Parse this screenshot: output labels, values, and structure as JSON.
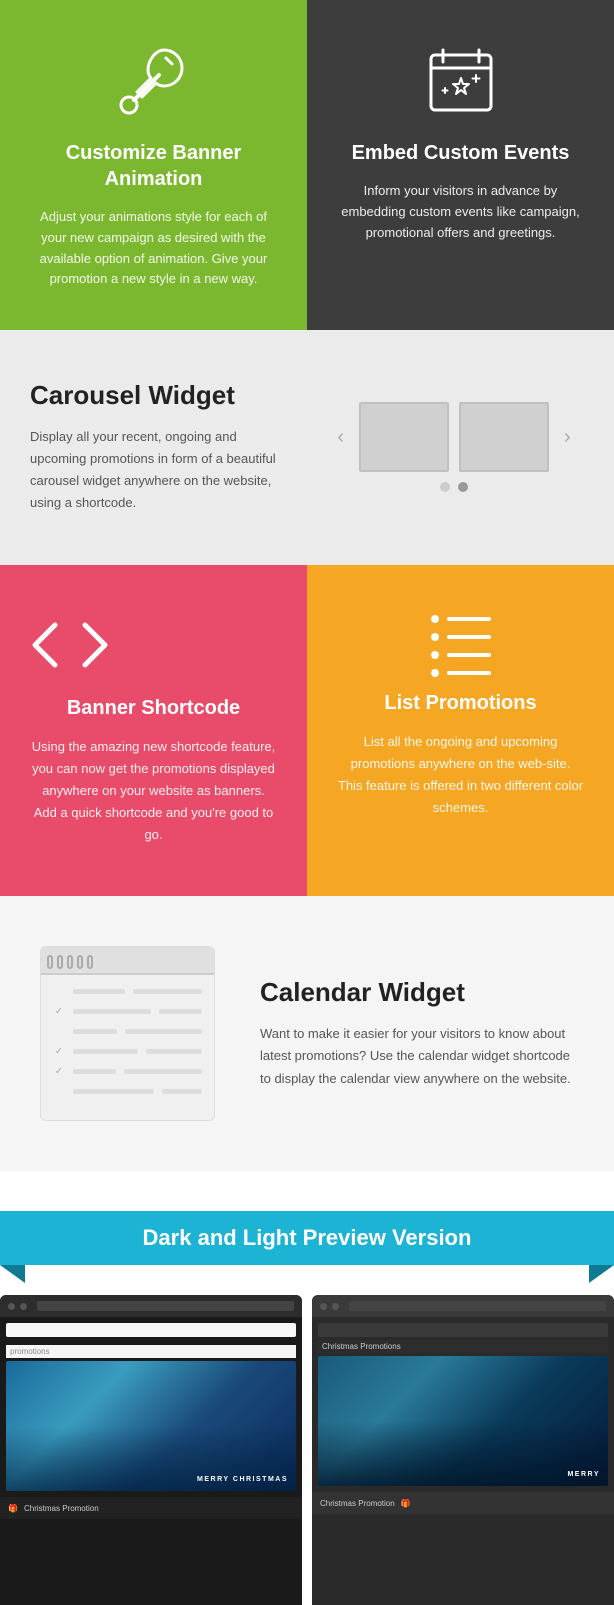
{
  "topLeft": {
    "title": "Customize Banner Animation",
    "desc": "Adjust your animations style for each of your new campaign as desired with the available option of animation. Give your promotion a new style in a new way.",
    "bgColor": "#7cb82f"
  },
  "topRight": {
    "title": "Embed Custom Events",
    "desc": "Inform your visitors in advance by embedding custom events like campaign, promotional offers and greetings.",
    "bgColor": "#3d3d3d"
  },
  "carousel": {
    "title": "Carousel Widget",
    "desc": "Display all your recent, ongoing and upcoming promotions in form of a beautiful carousel widget anywhere on the website, using a shortcode.",
    "prevArrow": "‹",
    "nextArrow": "›"
  },
  "bannerShortcode": {
    "title": "Banner Shortcode",
    "desc": "Using the amazing new shortcode feature, you can now get the promotions displayed anywhere on your website as banners. Add a quick shortcode and you're good to go.",
    "icon": "</>"
  },
  "listPromotions": {
    "title": "List Promotions",
    "desc": "List all the ongoing and upcoming promotions anywhere on the web-site. This feature is offered in two different color schemes."
  },
  "calendarWidget": {
    "title": "Calendar Widget",
    "desc": "Want to make it easier for your visitors to know about latest promotions? Use the calendar widget shortcode to display the calendar view anywhere on the website."
  },
  "previewBanner": {
    "title": "Dark and Light Preview Version"
  },
  "screenLeft": {
    "label": "promotions",
    "merrychristmas": "MERRY CHRISTMAS",
    "footer": "Christmas Promotion"
  },
  "screenRight": {
    "label": "Christmas Promotions",
    "merrychristmas": "MERRY",
    "footer": "Christmas Promotion"
  }
}
